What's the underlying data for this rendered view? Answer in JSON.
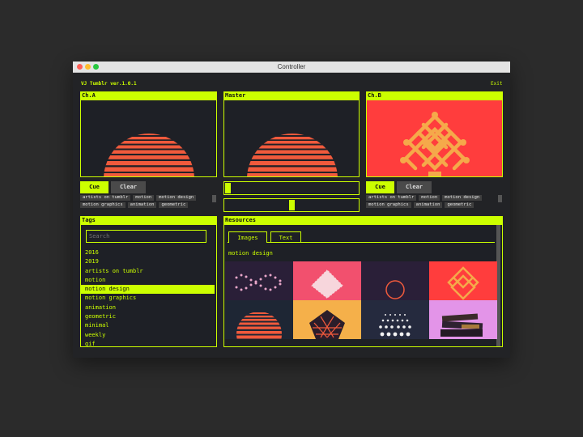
{
  "window": {
    "title": "Controller",
    "app_name": "VJ Tumblr ver.1.0.1",
    "exit_label": "Exit"
  },
  "channels": {
    "a": {
      "title": "Ch.A",
      "cue_label": "Cue",
      "clear_label": "Clear",
      "tags": [
        "artists on tumblr",
        "motion",
        "motion design",
        "motion graphics",
        "animation",
        "geometric"
      ]
    },
    "master": {
      "title": "Master"
    },
    "b": {
      "title": "Ch.B",
      "cue_label": "Cue",
      "clear_label": "Clear",
      "tags": [
        "artists on tumblr",
        "motion",
        "motion design",
        "motion graphics",
        "animation",
        "geometric"
      ]
    }
  },
  "tags_panel": {
    "title": "Tags",
    "search_placeholder": "Search",
    "items": [
      "2016",
      "2019",
      "artists on tumblr",
      "motion",
      "motion design",
      "motion graphics",
      "animation",
      "geometric",
      "minimal",
      "weekly",
      "gif"
    ],
    "selected": "motion design"
  },
  "resources_panel": {
    "title": "Resources",
    "tabs": [
      "Images",
      "Text"
    ],
    "active_tab": "Images",
    "current_tag": "motion design"
  },
  "colors": {
    "accent": "#ccff00",
    "background": "#222326",
    "sun_stripe": "#f05a3c",
    "chb_bg": "#ff3d3d",
    "knot": "#f5a94a"
  }
}
